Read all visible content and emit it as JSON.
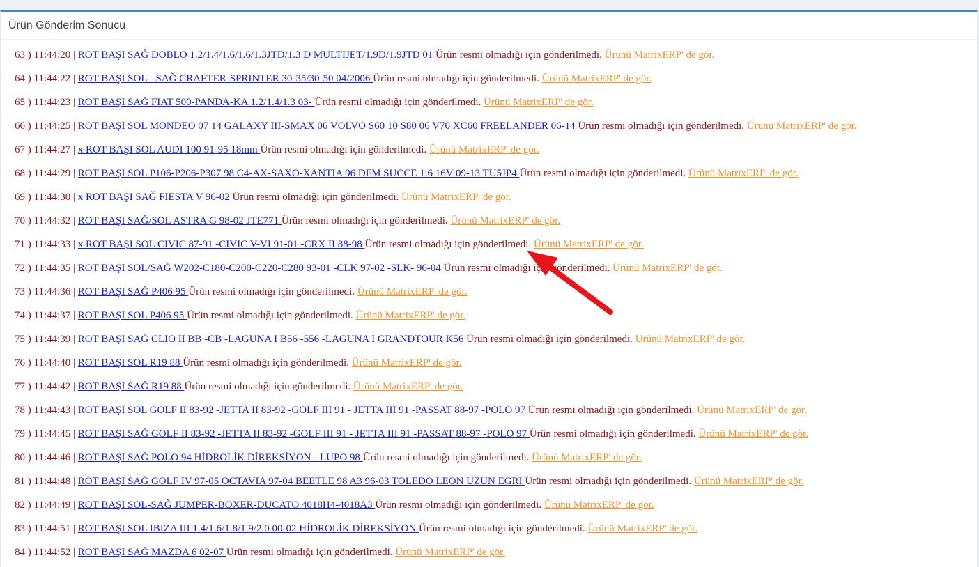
{
  "panel": {
    "title": "Ürün Gönderim Sonucu"
  },
  "colors": {
    "accent_border": "#3c8dbc",
    "row_text": "#8b1a1a",
    "product_link": "#1a22c8",
    "erp_link": "#f0922e",
    "annotation_arrow": "#e8141b"
  },
  "annotation": {
    "icon": "red-arrow-icon"
  },
  "rows": [
    {
      "prefix": "63 ) 11:44:20 | ",
      "product": "ROT BAŞI SAĞ DOBLO 1.2/1.4/1.6/1.6/1.3JTD/1.3 D MULTIJET/1.9D/1.9JTD 01 ",
      "message": "Ürün resmi olmadığı için gönderilmedi. ",
      "erp_link": "Ürünü MatrixERP' de gör."
    },
    {
      "prefix": "64 ) 11:44:22 | ",
      "product": "ROT BAŞI SOL - SAĞ CRAFTER-SPRINTER 30-35/30-50 04/2006 ",
      "message": "Ürün resmi olmadığı için gönderilmedi. ",
      "erp_link": "Ürünü MatrixERP' de gör."
    },
    {
      "prefix": "65 ) 11:44:23 | ",
      "product": "ROT BAŞI SAĞ FIAT 500-PANDA-KA 1.2/1.4/1.3 03- ",
      "message": "Ürün resmi olmadığı için gönderilmedi. ",
      "erp_link": "Ürünü MatrixERP' de gör."
    },
    {
      "prefix": "66 ) 11:44:25 | ",
      "product": "ROT BAŞI SOL MONDEO 07 14 GALAXY III-SMAX 06 VOLVO S60 10 S80 06 V70 XC60 FREELANDER 06-14 ",
      "message": "Ürün resmi olmadığı için gönderilmedi. ",
      "erp_link": "Ürünü MatrixERP' de gör."
    },
    {
      "prefix": "67 ) 11:44:27 | ",
      "product": "x ROT BAŞI SOL AUDI 100 91-95 18mm ",
      "message": "Ürün resmi olmadığı için gönderilmedi. ",
      "erp_link": "Ürünü MatrixERP' de gör."
    },
    {
      "prefix": "68 ) 11:44:29 | ",
      "product": "ROT BAŞI SOL P106-P206-P307 98 C4-AX-SAXO-XANTIA 96 DFM SUCCE 1.6 16V 09-13 TU5JP4 ",
      "message": "Ürün resmi olmadığı için gönderilmedi. ",
      "erp_link": "Ürünü MatrixERP' de gör."
    },
    {
      "prefix": "69 ) 11:44:30 | ",
      "product": "x ROT BAŞI SAĞ FIESTA V 96-02 ",
      "message": "Ürün resmi olmadığı için gönderilmedi. ",
      "erp_link": "Ürünü MatrixERP' de gör."
    },
    {
      "prefix": "70 ) 11:44:32 | ",
      "product": "ROT BAŞI SAĞ/SOL ASTRA G 98-02 JTE771 ",
      "message": "Ürün resmi olmadığı için gönderilmedi. ",
      "erp_link": "Ürünü MatrixERP' de gör."
    },
    {
      "prefix": "71 ) 11:44:33 | ",
      "product": "x ROT BAŞI SOL CIVIC 87-91 -CIVIC V-VI 91-01 -CRX II 88-98 ",
      "message": "Ürün resmi olmadığı için gönderilmedi. ",
      "erp_link": "Ürünü MatrixERP' de gör."
    },
    {
      "prefix": "72 ) 11:44:35 | ",
      "product": "ROT BAŞI SOL/SAĞ W202-C180-C200-C220-C280 93-01 -CLK 97-02 -SLK- 96-04 ",
      "message": "Ürün resmi olmadığı için gönderilmedi. ",
      "erp_link": "Ürünü MatrixERP' de gör."
    },
    {
      "prefix": "73 ) 11:44:36 | ",
      "product": "ROT BAŞI SAĞ P406 95 ",
      "message": "Ürün resmi olmadığı için gönderilmedi. ",
      "erp_link": "Ürünü MatrixERP' de gör."
    },
    {
      "prefix": "74 ) 11:44:37 | ",
      "product": "ROT BAŞI SOL P406 95 ",
      "message": "Ürün resmi olmadığı için gönderilmedi. ",
      "erp_link": "Ürünü MatrixERP' de gör."
    },
    {
      "prefix": "75 ) 11:44:39 | ",
      "product": "ROT BAŞI SAĞ CLIO II BB -CB -LAGUNA I B56 -556 -LAGUNA I GRANDTOUR K56 ",
      "message": "Ürün resmi olmadığı için gönderilmedi. ",
      "erp_link": "Ürünü MatrixERP' de gör."
    },
    {
      "prefix": "76 ) 11:44:40 | ",
      "product": "ROT BAŞI SOL R19 88 ",
      "message": "Ürün resmi olmadığı için gönderilmedi. ",
      "erp_link": "Ürünü MatrixERP' de gör."
    },
    {
      "prefix": "77 ) 11:44:42 | ",
      "product": "ROT BAŞI SAĞ R19 88 ",
      "message": "Ürün resmi olmadığı için gönderilmedi. ",
      "erp_link": "Ürünü MatrixERP' de gör."
    },
    {
      "prefix": "78 ) 11:44:43 | ",
      "product": "ROT BAŞI SOL GOLF II 83-92 -JETTA II 83-92 -GOLF III 91 - JETTA III 91 -PASSAT 88-97 -POLO 97 ",
      "message": "Ürün resmi olmadığı için gönderilmedi. ",
      "erp_link": "Ürünü MatrixERP' de gör."
    },
    {
      "prefix": "79 ) 11:44:45 | ",
      "product": "ROT BAŞI SAĞ GOLF II 83-92 -JETTA II 83-92 -GOLF III 91 - JETTA III 91 -PASSAT 88-97 -POLO 97 ",
      "message": "Ürün resmi olmadığı için gönderilmedi. ",
      "erp_link": "Ürünü MatrixERP' de gör."
    },
    {
      "prefix": "80 ) 11:44:46 | ",
      "product": "ROT BAŞI SAĞ POLO 94 HİDROLİK DİREKSİYON - LUPO 98 ",
      "message": "Ürün resmi olmadığı için gönderilmedi. ",
      "erp_link": "Ürünü MatrixERP' de gör."
    },
    {
      "prefix": "81 ) 11:44:48 | ",
      "product": "ROT BAŞI SAĞ GOLF IV 97-05 OCTAVIA 97-04 BEETLE 98 A3 96-03 TOLEDO LEON UZUN EGRI ",
      "message": "Ürün resmi olmadığı için gönderilmedi. ",
      "erp_link": "Ürünü MatrixERP' de gör."
    },
    {
      "prefix": "82 ) 11:44:49 | ",
      "product": "ROT BAŞI SOL-SAĞ JUMPER-BOXER-DUCATO 4018H4-4018A3 ",
      "message": "Ürün resmi olmadığı için gönderilmedi. ",
      "erp_link": "Ürünü MatrixERP' de gör."
    },
    {
      "prefix": "83 ) 11:44:51 | ",
      "product": "ROT BAŞI SOL IBIZA III 1.4/1.6/1.8/1.9/2.0 00-02 HİDROLİK DİREKSİYON ",
      "message": "Ürün resmi olmadığı için gönderilmedi. ",
      "erp_link": "Ürünü MatrixERP' de gör."
    },
    {
      "prefix": "84 ) 11:44:52 | ",
      "product": "ROT BAŞI SAĞ MAZDA 6 02-07 ",
      "message": "Ürün resmi olmadığı için gönderilmedi. ",
      "erp_link": "Ürünü MatrixERP' de gör."
    }
  ]
}
